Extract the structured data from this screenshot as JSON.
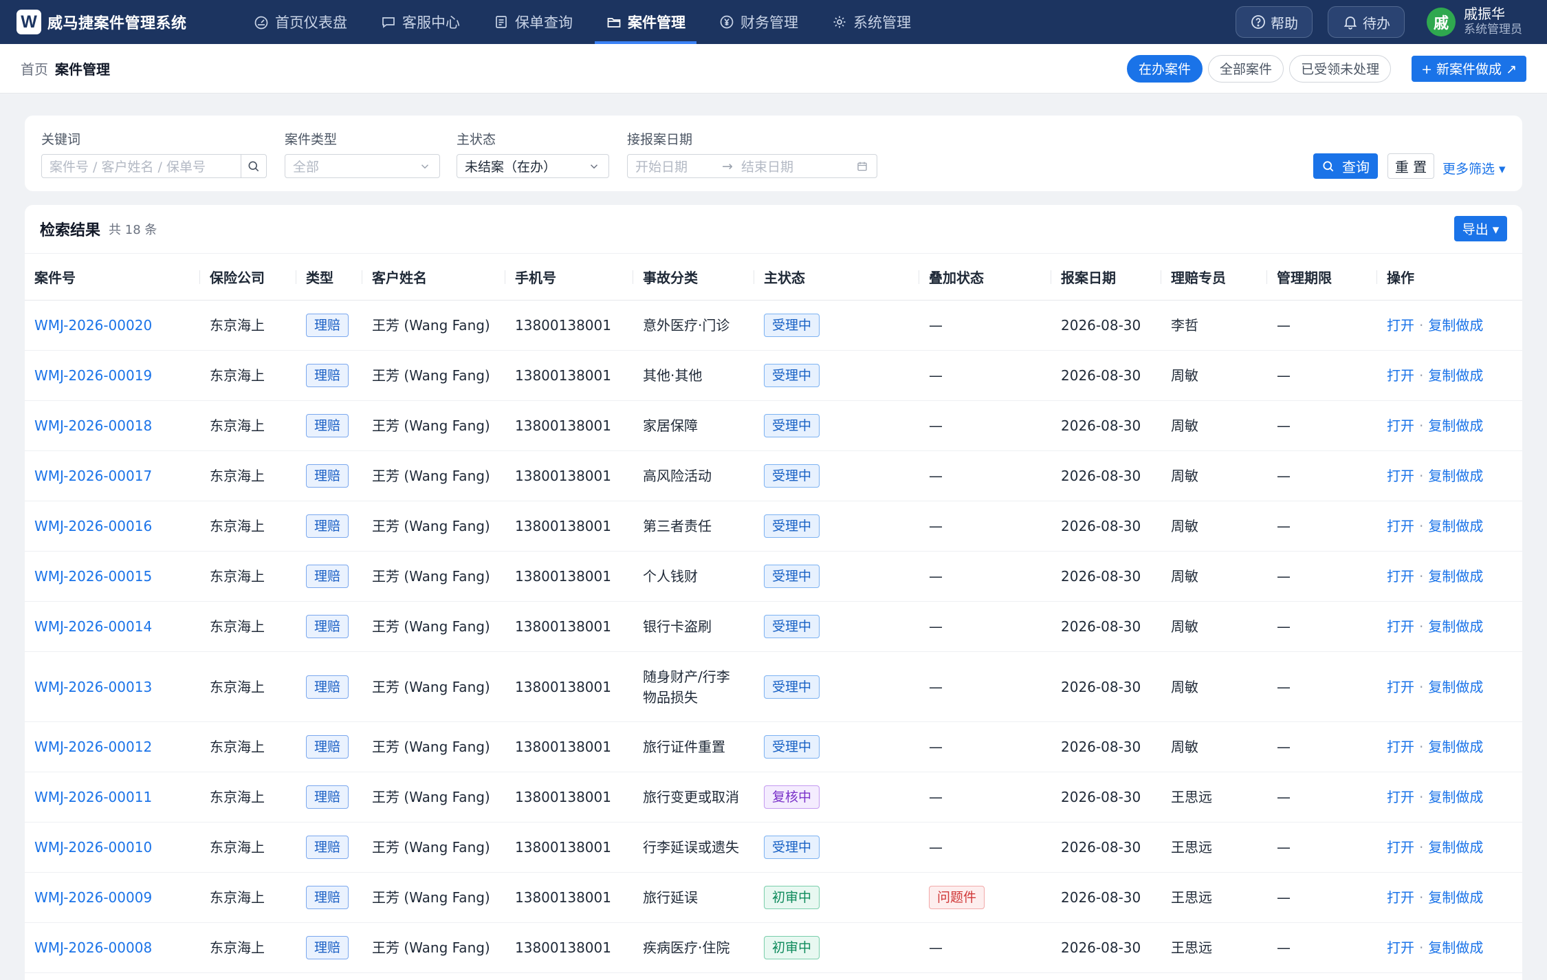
{
  "app": {
    "logo_letter": "W",
    "name": "威马捷案件管理系统"
  },
  "nav": [
    {
      "label": "首页仪表盘",
      "icon": "dashboard-icon",
      "active": false
    },
    {
      "label": "客服中心",
      "icon": "chat-icon",
      "active": false
    },
    {
      "label": "保单查询",
      "icon": "document-icon",
      "active": false
    },
    {
      "label": "案件管理",
      "icon": "folder-icon",
      "active": true
    },
    {
      "label": "财务管理",
      "icon": "yen-icon",
      "active": false
    },
    {
      "label": "系统管理",
      "icon": "gear-icon",
      "active": false
    }
  ],
  "top_actions": {
    "help": "帮助",
    "todo": "待办"
  },
  "user": {
    "avatar_char": "戚",
    "name": "戚振华",
    "role": "系统管理员"
  },
  "breadcrumb": {
    "home": "首页",
    "current": "案件管理"
  },
  "scope_tabs": [
    {
      "label": "在办案件",
      "active": true
    },
    {
      "label": "全部案件",
      "active": false
    },
    {
      "label": "已受领未处理",
      "active": false
    }
  ],
  "new_case_label": "+ 新案件做成 ↗",
  "filters": {
    "keyword": {
      "label": "关键词",
      "placeholder": "案件号 / 客户姓名 / 保单号"
    },
    "case_type": {
      "label": "案件类型",
      "value": "全部"
    },
    "main_status": {
      "label": "主状态",
      "value": "未结案（在办）"
    },
    "report_date": {
      "label": "接报案日期",
      "start_placeholder": "开始日期",
      "arrow": "→",
      "end_placeholder": "结束日期"
    },
    "query_label": "查询",
    "reset_label": "重 置",
    "more_label": "更多筛选 ▾"
  },
  "results": {
    "title": "检索结果",
    "count": "共 18 条",
    "export_label": "导出 ▾",
    "columns": [
      "案件号",
      "保险公司",
      "类型",
      "客户姓名",
      "手机号",
      "事故分类",
      "主状态",
      "叠加状态",
      "报案日期",
      "理赔专员",
      "管理期限",
      "操作"
    ],
    "op_open": "打开",
    "op_sep": "·",
    "op_copy": "复制做成",
    "rows": [
      {
        "id": "WMJ-2026-00020",
        "insurer": "东京海上",
        "type": "理赔",
        "customer": "王芳 (Wang Fang)",
        "phone": "13800138001",
        "accident": "意外医疗·门诊",
        "status": "受理中",
        "status_color": "blue",
        "overlay": "—",
        "overlay_tag": false,
        "date": "2026-08-30",
        "agent": "李哲",
        "deadline": "—"
      },
      {
        "id": "WMJ-2026-00019",
        "insurer": "东京海上",
        "type": "理赔",
        "customer": "王芳 (Wang Fang)",
        "phone": "13800138001",
        "accident": "其他·其他",
        "status": "受理中",
        "status_color": "blue",
        "overlay": "—",
        "overlay_tag": false,
        "date": "2026-08-30",
        "agent": "周敏",
        "deadline": "—"
      },
      {
        "id": "WMJ-2026-00018",
        "insurer": "东京海上",
        "type": "理赔",
        "customer": "王芳 (Wang Fang)",
        "phone": "13800138001",
        "accident": "家居保障",
        "status": "受理中",
        "status_color": "blue",
        "overlay": "—",
        "overlay_tag": false,
        "date": "2026-08-30",
        "agent": "周敏",
        "deadline": "—"
      },
      {
        "id": "WMJ-2026-00017",
        "insurer": "东京海上",
        "type": "理赔",
        "customer": "王芳 (Wang Fang)",
        "phone": "13800138001",
        "accident": "高风险活动",
        "status": "受理中",
        "status_color": "blue",
        "overlay": "—",
        "overlay_tag": false,
        "date": "2026-08-30",
        "agent": "周敏",
        "deadline": "—"
      },
      {
        "id": "WMJ-2026-00016",
        "insurer": "东京海上",
        "type": "理赔",
        "customer": "王芳 (Wang Fang)",
        "phone": "13800138001",
        "accident": "第三者责任",
        "status": "受理中",
        "status_color": "blue",
        "overlay": "—",
        "overlay_tag": false,
        "date": "2026-08-30",
        "agent": "周敏",
        "deadline": "—"
      },
      {
        "id": "WMJ-2026-00015",
        "insurer": "东京海上",
        "type": "理赔",
        "customer": "王芳 (Wang Fang)",
        "phone": "13800138001",
        "accident": "个人钱财",
        "status": "受理中",
        "status_color": "blue",
        "overlay": "—",
        "overlay_tag": false,
        "date": "2026-08-30",
        "agent": "周敏",
        "deadline": "—"
      },
      {
        "id": "WMJ-2026-00014",
        "insurer": "东京海上",
        "type": "理赔",
        "customer": "王芳 (Wang Fang)",
        "phone": "13800138001",
        "accident": "银行卡盗刷",
        "status": "受理中",
        "status_color": "blue",
        "overlay": "—",
        "overlay_tag": false,
        "date": "2026-08-30",
        "agent": "周敏",
        "deadline": "—"
      },
      {
        "id": "WMJ-2026-00013",
        "insurer": "东京海上",
        "type": "理赔",
        "customer": "王芳 (Wang Fang)",
        "phone": "13800138001",
        "accident": "随身财产/行李物品损失",
        "status": "受理中",
        "status_color": "blue",
        "overlay": "—",
        "overlay_tag": false,
        "date": "2026-08-30",
        "agent": "周敏",
        "deadline": "—",
        "tall": true
      },
      {
        "id": "WMJ-2026-00012",
        "insurer": "东京海上",
        "type": "理赔",
        "customer": "王芳 (Wang Fang)",
        "phone": "13800138001",
        "accident": "旅行证件重置",
        "status": "受理中",
        "status_color": "blue",
        "overlay": "—",
        "overlay_tag": false,
        "date": "2026-08-30",
        "agent": "周敏",
        "deadline": "—"
      },
      {
        "id": "WMJ-2026-00011",
        "insurer": "东京海上",
        "type": "理赔",
        "customer": "王芳 (Wang Fang)",
        "phone": "13800138001",
        "accident": "旅行变更或取消",
        "status": "复核中",
        "status_color": "purple",
        "overlay": "—",
        "overlay_tag": false,
        "date": "2026-08-30",
        "agent": "王思远",
        "deadline": "—"
      },
      {
        "id": "WMJ-2026-00010",
        "insurer": "东京海上",
        "type": "理赔",
        "customer": "王芳 (Wang Fang)",
        "phone": "13800138001",
        "accident": "行李延误或遗失",
        "status": "受理中",
        "status_color": "blue",
        "overlay": "—",
        "overlay_tag": false,
        "date": "2026-08-30",
        "agent": "王思远",
        "deadline": "—"
      },
      {
        "id": "WMJ-2026-00009",
        "insurer": "东京海上",
        "type": "理赔",
        "customer": "王芳 (Wang Fang)",
        "phone": "13800138001",
        "accident": "旅行延误",
        "status": "初审中",
        "status_color": "green",
        "overlay": "问题件",
        "overlay_tag": true,
        "date": "2026-08-30",
        "agent": "王思远",
        "deadline": "—"
      },
      {
        "id": "WMJ-2026-00008",
        "insurer": "东京海上",
        "type": "理赔",
        "customer": "王芳 (Wang Fang)",
        "phone": "13800138001",
        "accident": "疾病医疗·住院",
        "status": "初审中",
        "status_color": "green",
        "overlay": "—",
        "overlay_tag": false,
        "date": "2026-08-30",
        "agent": "王思远",
        "deadline": "—"
      }
    ]
  }
}
